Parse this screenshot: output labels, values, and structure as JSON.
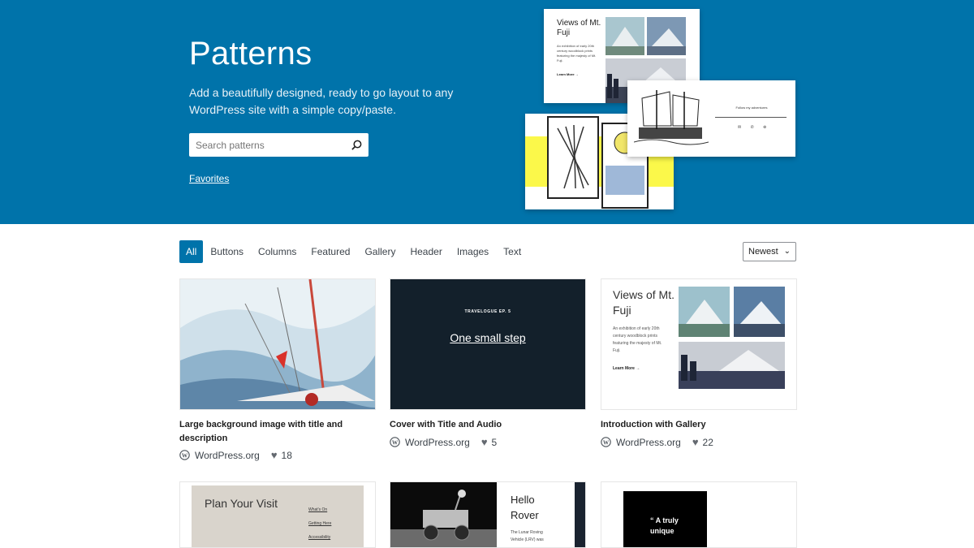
{
  "hero": {
    "title": "Patterns",
    "description": "Add a beautifully designed, ready to go layout to any WordPress site with a simple copy/paste.",
    "search_placeholder": "Search patterns",
    "favorites_label": "Favorites",
    "collage": {
      "fuji_title": "Views of Mt. Fuji",
      "fuji_desc": "An exhibition of early 20th century woodblock prints featuring the majesty of Mt. Fuji.",
      "fuji_link": "Learn More →",
      "follow_label": "Follow my adventures",
      "social_icons": "✉ ✆ ⊚"
    }
  },
  "filters": {
    "tabs": [
      "All",
      "Buttons",
      "Columns",
      "Featured",
      "Gallery",
      "Header",
      "Images",
      "Text"
    ],
    "active": "All",
    "sort_label": "Newest"
  },
  "patterns": [
    {
      "title": "Large background image with title and description",
      "author": "WordPress.org",
      "likes": "18"
    },
    {
      "title": "Cover with Title and Audio",
      "author": "WordPress.org",
      "likes": "5",
      "preview_kicker": "TRAVELOGUE EP. 5",
      "preview_title": "One small step"
    },
    {
      "title": "Introduction with Gallery",
      "author": "WordPress.org",
      "likes": "22",
      "preview_title": "Views of Mt. Fuji",
      "preview_desc": "An exhibition of early 20th century woodblock prints featuring the majesty of Mt. Fuji.",
      "preview_link": "Learn More →"
    },
    {
      "preview_title": "Plan Your Visit",
      "preview_links": [
        "What's On",
        "Getting Here",
        "Accessibility"
      ]
    },
    {
      "preview_title": "Hello Rover",
      "preview_desc": "The Lunar Roving Vehicle (LRV) was"
    },
    {
      "preview_quote": "“ A truly unique"
    }
  ],
  "colors": {
    "brand_blue": "#0073aa",
    "text": "#1e1e1e",
    "meta": "#3c434a"
  },
  "icons": {
    "search": "search-icon",
    "wp": "wordpress-icon",
    "heart": "heart-icon",
    "chevron": "chevron-down-icon"
  }
}
